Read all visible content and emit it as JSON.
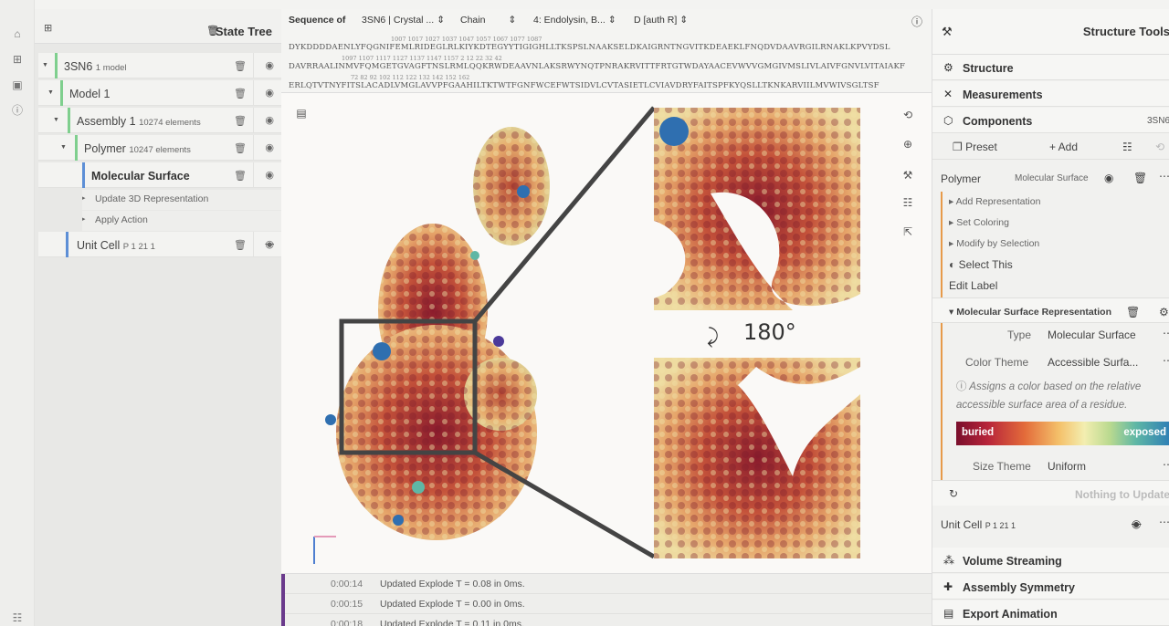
{
  "rail": {
    "icons": [
      "home-icon",
      "tree-icon",
      "save-icon",
      "help-icon",
      "settings-icon"
    ]
  },
  "tree": {
    "title": "State Tree",
    "nodes": [
      {
        "label": "3SN6",
        "sub": "1 model"
      },
      {
        "label": "Model 1",
        "sub": ""
      },
      {
        "label": "Assembly 1",
        "sub": "10274 elements"
      },
      {
        "label": "Polymer",
        "sub": "10247 elements"
      },
      {
        "label": "Molecular Surface",
        "sub": ""
      },
      {
        "label": "Unit Cell",
        "sub": "P 1 21 1"
      }
    ],
    "actions": [
      "Update 3D Representation",
      "Apply Action"
    ]
  },
  "sequence": {
    "label": "Sequence of",
    "structure": "3SN6 | Crystal ...",
    "mode": "Chain",
    "entity": "4: Endolysin, B...",
    "chain": "D [auth R]",
    "numbers": [
      "1007            1017            1027            1037            1047            1057            1067            1077            1087",
      "1097            1107            1117            1127            1137            1147            1157            2               12              22              32              42",
      "72              82              92              102             112             122             132             142             152             162"
    ],
    "lines": [
      "DYKDDDDAENLYFQGNIFEMLRIDEGLRLKIYKDTEGYYTIGIGHLLTKSPSLNAAKSELDKAIGRNTNGVITKDEAEKLFNQDVDAAVRGILRNAKLKPVYDSL",
      "DAVRRAALINMVFQMGETGVAGFTNSLRMLQQKRWDEAAVNLAKSRWYNQTPNRAKRVITTFRTGTWDAYAACEVWVVGMGIVMSLIVLAIVFGNVLVITAIAKF",
      "ERLQTVTNYFITSLACADLVMGLAVVPFGAAHILTKTWTFGNFWCEFWTSIDVLCVTASIETLCVIAVDRYFAITSPFKYQSLLTKNKARVIILMVWIVSGLTSF"
    ]
  },
  "viewport": {
    "rotation_label": "180°"
  },
  "log": [
    {
      "time": "0:00:14",
      "msg": "Updated Explode T = 0.08 in 0ms."
    },
    {
      "time": "0:00:15",
      "msg": "Updated Explode T = 0.00 in 0ms."
    },
    {
      "time": "0:00:18",
      "msg": "Updated Explode T = 0.11 in 0ms."
    }
  ],
  "right": {
    "title": "Structure Tools",
    "sections": [
      "Structure",
      "Measurements",
      "Components"
    ],
    "components_id": "3SN6",
    "preset": "Preset",
    "add": "+ Add",
    "polymer": "Polymer",
    "polymer_rep": "Molecular Surface",
    "actions": [
      "Add Representation",
      "Set Coloring",
      "Modify by Selection"
    ],
    "select_this": "Select This",
    "edit_label": "Edit Label",
    "rep_header": "Molecular Surface Representation",
    "type_label": "Type",
    "type_value": "Molecular Surface",
    "color_label": "Color Theme",
    "color_value": "Accessible Surfa...",
    "color_desc": "Assigns a color based on the relative accessible surface area of a residue.",
    "legend_low": "buried",
    "legend_high": "exposed",
    "size_label": "Size Theme",
    "size_value": "Uniform",
    "update": "Nothing to Update",
    "unit_cell": "Unit Cell",
    "unit_cell_sub": "P 1 21 1",
    "bottom_sections": [
      "Volume Streaming",
      "Assembly Symmetry",
      "Export Animation"
    ]
  },
  "colors": {
    "accent_green": "#7fcf8e",
    "accent_blue": "#5d8fd6",
    "accent_orange": "#e79a4a",
    "log_purple": "#6a3a8c"
  }
}
